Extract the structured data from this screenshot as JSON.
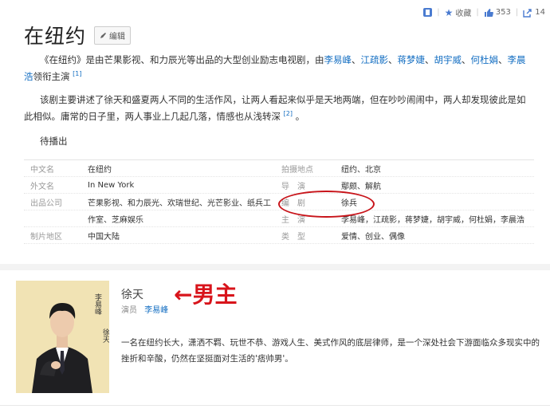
{
  "toolbar": {
    "favorite_label": "收藏",
    "like_count": "353",
    "share_count": "14"
  },
  "header": {
    "title": "在纽约",
    "edit_label": "编辑"
  },
  "intro": {
    "p1_prefix": "《在纽约》是由芒果影视、和力辰光等出品的大型创业励志电视剧，由",
    "actors": [
      "李易峰",
      "江疏影",
      "蒋梦婕",
      "胡宇威",
      "何杜娟",
      "李晨浩"
    ],
    "actor_sep": "、",
    "p1_suffix": "领衔主演",
    "ref1": "[1]",
    "p2": "该剧主要讲述了徐天和盛夏两人不同的生活作风，让两人看起来似乎是天地两端，但在吵吵闹闹中，两人却发现彼此是如此相似。庸常的日子里，两人事业上几起几落，情感也从浅转深",
    "ref2": "[2]",
    "p2_end": "。",
    "upcoming": "待播出"
  },
  "info": {
    "rows": [
      {
        "l1": "中文名",
        "v1": "在纽约",
        "l2": "拍摄地点",
        "v2": "纽约、北京",
        "v2_link": false
      },
      {
        "l1": "外文名",
        "v1": "In New York",
        "l2": "导　演",
        "v2": "鄢颇、解航",
        "v2_link": true
      },
      {
        "l1": "出品公司",
        "v1": "芒果影视、和力辰光、欢瑞世纪、光芒影业、纸兵工",
        "l2": "编　剧",
        "v2": "徐兵",
        "v2_link": false
      },
      {
        "l1": "",
        "v1": "作室、芝麻娱乐",
        "l2": "主　演",
        "v2": "李易峰，江疏影，蒋梦婕，胡宇威，何杜娟，李晨浩",
        "v2_link": true
      },
      {
        "l1": "制片地区",
        "v1": "中国大陆",
        "l2": "类　型",
        "v2": "爱情、创业、偶像",
        "v2_link": false
      }
    ]
  },
  "character": {
    "name": "徐天",
    "annotation": "←男主",
    "role_label": "演员",
    "actor": "李易峰",
    "portrait_caption": "李易峰",
    "portrait_role": "徐天",
    "description": "一名在纽约长大，潇洒不羁、玩世不恭、游戏人生、美式作风的底层律师，是一个深处社会下游面临众多现实中的挫折和辛酸，仍然在坚挺面对生活的'痞帅男'。"
  },
  "colors": {
    "link": "#136ec2",
    "accent_red": "#d8141b",
    "icon_blue": "#4a7bd0"
  }
}
